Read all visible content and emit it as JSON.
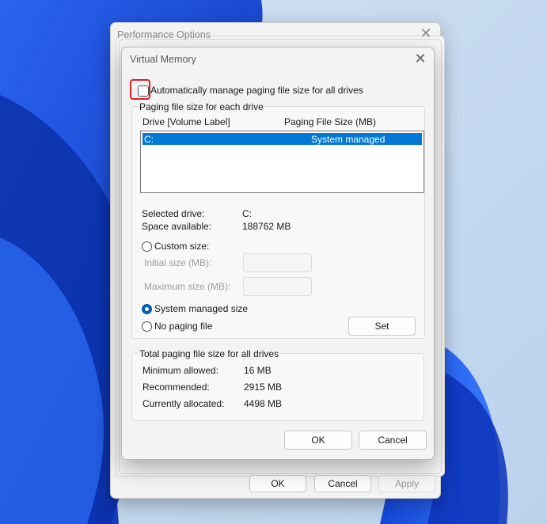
{
  "performance_options": {
    "title": "Performance Options",
    "buttons": {
      "ok": "OK",
      "cancel": "Cancel",
      "apply": "Apply"
    }
  },
  "virtual_memory": {
    "title": "Virtual Memory",
    "auto_manage": {
      "label": "Automatically manage paging file size for all drives",
      "checked": false
    },
    "per_drive_group": {
      "title": "Paging file size for each drive",
      "columns": {
        "drive": "Drive  [Volume Label]",
        "size": "Paging File Size (MB)"
      },
      "rows": [
        {
          "drive": "C:",
          "size": "System managed"
        }
      ],
      "selected_drive_label": "Selected drive:",
      "selected_drive_value": "C:",
      "space_available_label": "Space available:",
      "space_available_value": "188762 MB",
      "custom_size": "Custom size:",
      "initial_size_label": "Initial size (MB):",
      "maximum_size_label": "Maximum size (MB):",
      "system_managed": "System managed size",
      "no_paging": "No paging file",
      "set_button": "Set",
      "selected_option": "system_managed"
    },
    "total_group": {
      "title": "Total paging file size for all drives",
      "minimum_label": "Minimum allowed:",
      "minimum_value": "16 MB",
      "recommended_label": "Recommended:",
      "recommended_value": "2915 MB",
      "allocated_label": "Currently allocated:",
      "allocated_value": "4498 MB"
    },
    "buttons": {
      "ok": "OK",
      "cancel": "Cancel"
    }
  },
  "colors": {
    "accent": "#0078d4",
    "highlight_border": "#e01f26",
    "wallpaper_blue": "#1f4fd8"
  }
}
